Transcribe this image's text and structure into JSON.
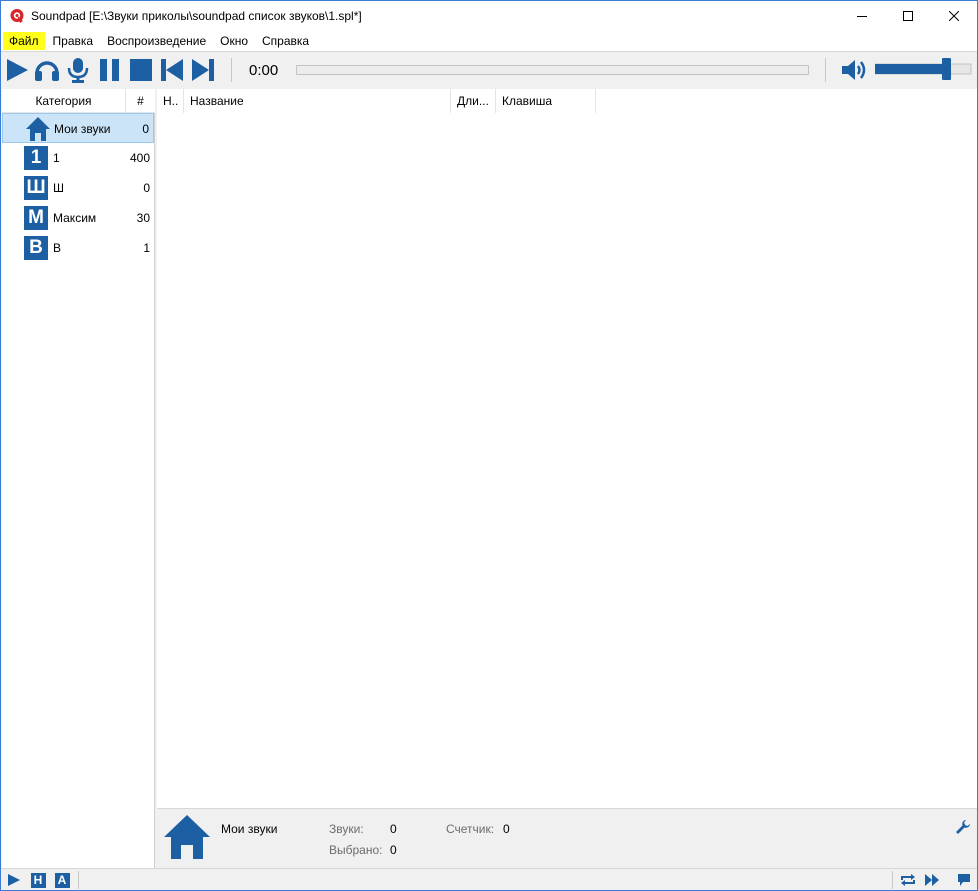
{
  "window": {
    "title": "Soundpad [E:\\Звуки приколы\\soundpad список звуков\\1.spl*]"
  },
  "menu": [
    {
      "label": "Файл"
    },
    {
      "label": "Правка"
    },
    {
      "label": "Воспроизведение"
    },
    {
      "label": "Окно"
    },
    {
      "label": "Справка"
    }
  ],
  "toolbar": {
    "time": "0:00",
    "seek_progress": 0,
    "volume_level": 0.74,
    "buttons": [
      "play-icon",
      "headphones-icon",
      "microphone-icon",
      "pause-icon",
      "stop-icon",
      "previous-icon",
      "next-icon"
    ],
    "accent": "#1c5fa3"
  },
  "categories_header": {
    "name": "Категория",
    "count": "#"
  },
  "categories": [
    {
      "icon": "home-icon",
      "name": "Мои звуки",
      "count": "0",
      "selected": true
    },
    {
      "icon_letter": "1",
      "name": "1",
      "count": "400"
    },
    {
      "icon_letter": "Ш",
      "name": "Ш",
      "count": "0"
    },
    {
      "icon_letter": "М",
      "name": "Максим",
      "count": "30"
    },
    {
      "icon_letter": "В",
      "name": "В",
      "count": "1"
    }
  ],
  "sounds_table": {
    "columns": [
      "Н..",
      "Название",
      "Дли...",
      "Клавиша"
    ],
    "rows": []
  },
  "info": {
    "category": "Мои звуки",
    "sounds_label": "Звуки:",
    "sounds_value": "0",
    "selected_label": "Выбрано:",
    "selected_value": "0",
    "counter_label": "Счетчик:",
    "counter_value": "0"
  },
  "statusbar": {
    "letters": [
      "Н",
      "А"
    ]
  }
}
